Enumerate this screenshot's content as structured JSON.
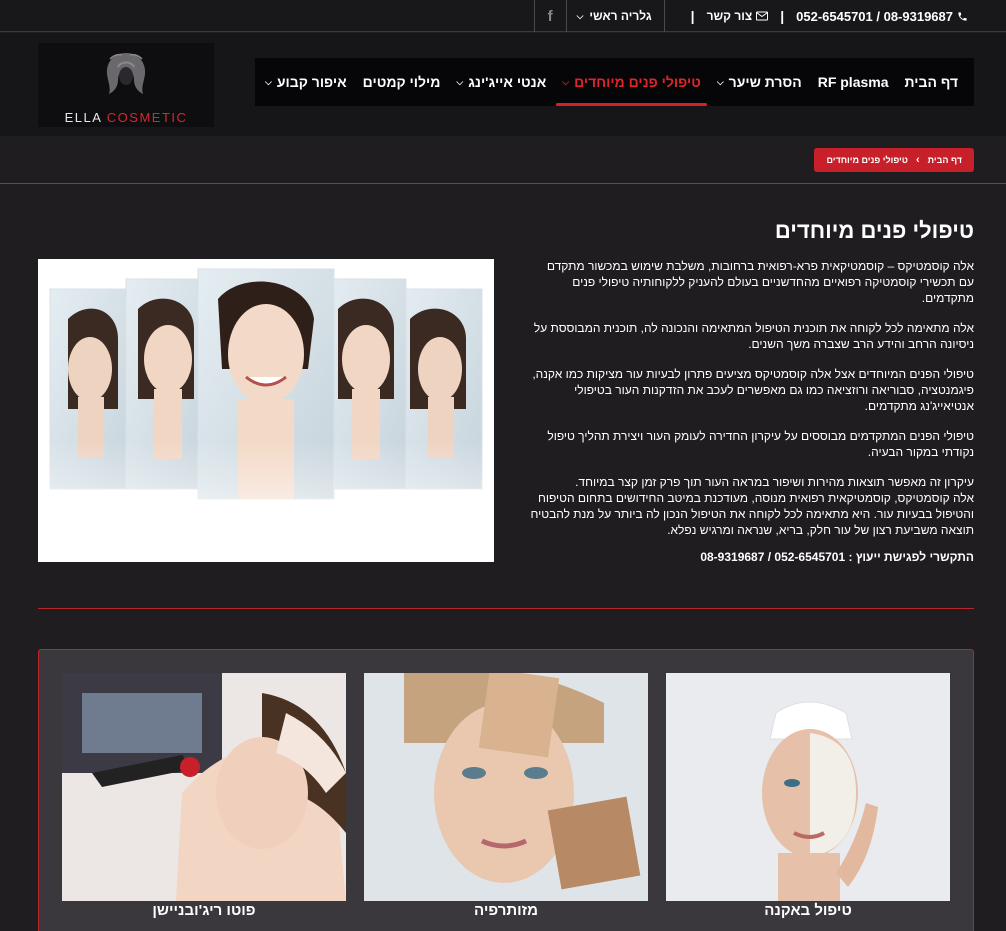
{
  "topbar": {
    "phone": "052-6545701 / 08-9319687",
    "contact": "צור קשר",
    "gallery": "גלריה ראשי",
    "facebook": "f"
  },
  "logo": {
    "name_part1": "ELLA",
    "name_part2": "COSMETIC"
  },
  "nav": {
    "items": [
      {
        "label": "דף הבית",
        "has_dropdown": false
      },
      {
        "label": "RF plasma",
        "has_dropdown": false
      },
      {
        "label": "הסרת שיער",
        "has_dropdown": true
      },
      {
        "label": "טיפולי פנים מיוחדים",
        "has_dropdown": true,
        "active": true
      },
      {
        "label": "אנטי אייג'ינג",
        "has_dropdown": true
      },
      {
        "label": "מילוי קמטים",
        "has_dropdown": false
      },
      {
        "label": "איפור קבוע",
        "has_dropdown": true
      }
    ]
  },
  "breadcrumb": {
    "home": "דף הבית",
    "current": "טיפולי פנים מיוחדים"
  },
  "page": {
    "title": "טיפולי פנים מיוחדים",
    "paragraphs": [
      "אלה קוסמטיקס – קוסמטיקאית פרא-רפואית ברחובות, משלבת שימוש במכשור מתקדם עם תכשירי קוסמטיקה רפואיים מהחדשניים בעולם להעניק ללקוחותיה טיפולי פנים מתקדמים.",
      "אלה מתאימה לכל לקוחה את תוכנית הטיפול המתאימה והנכונה לה, תוכנית המבוססת על ניסיונה הרחב והידע הרב שצברה משך השנים.",
      "טיפולי הפנים המיוחדים אצל אלה קוסמטיקס מציעים פתרון לבעיות עור מציקות כמו אקנה, פיגמנטציה, סבוריאה ורוזציאה כמו גם מאפשרים לעכב את הזדקנות העור בטיפולי אנטיאייג'נג מתקדמים.",
      "טיפולי הפנים המתקדמים מבוססים על עיקרון החדירה לעומק העור ויצירת תהליך טיפול נקודתי במקור הבעיה.",
      "עיקרון זה מאפשר תוצאות מהירות ושיפור במראה העור תוך פרק זמן קצר במיוחד.\nאלה קוסמטיקס, קוסמטיקאית רפואית מנוסה, מעודכנת במיטב החידושים בתחום הטיפוח והטיפול בבעיות עור. היא מתאימה לכל לקוחה את הטיפול הנכון לה ביותר על מנת להבטיח תוצאה משביעת רצון של עור חלק, בריא, שנראה ומרגיש נפלא."
    ],
    "cta_label": "התקשרי לפגישת ייעוץ :",
    "cta_phone": "052-6545701 / 08-9319687"
  },
  "cards": [
    {
      "label": "טיפול באקנה",
      "icon": "acne-treatment-photo"
    },
    {
      "label": "מזותרפיה",
      "icon": "mesotherapy-photo"
    },
    {
      "label": "פוטו ריג'ובניישן",
      "icon": "photo-rejuvenation-photo"
    }
  ],
  "colors": {
    "accent": "#c8202a",
    "background": "#1f1d20",
    "nav_bg": "#060507"
  }
}
